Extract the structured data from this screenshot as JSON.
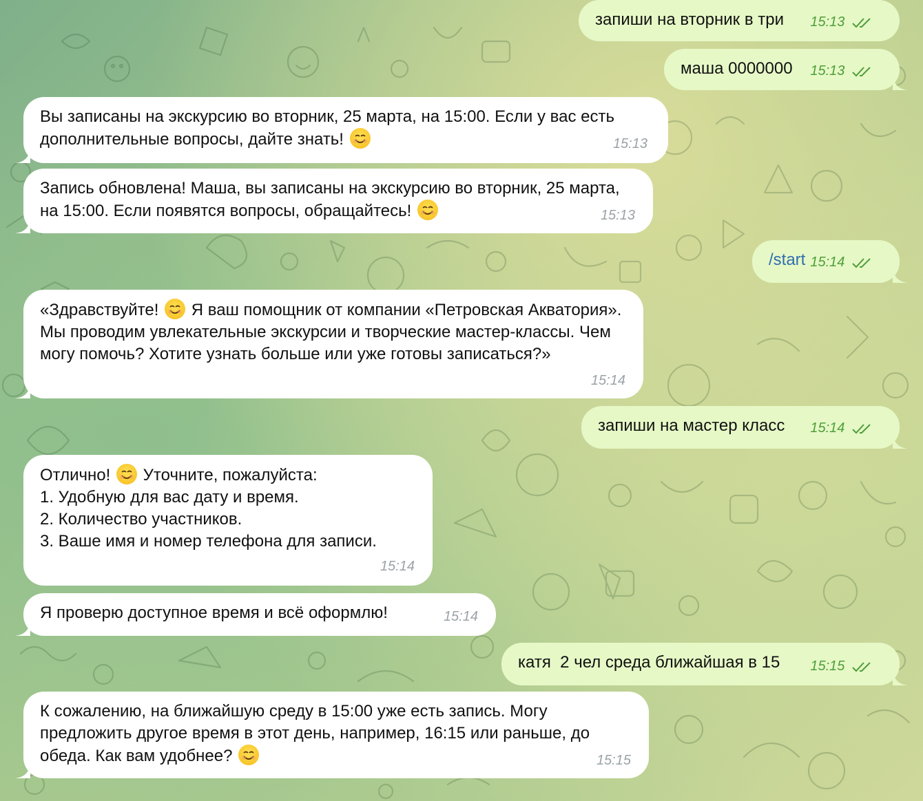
{
  "colors": {
    "incoming_bubble": "#ffffff",
    "outgoing_bubble": "#e6f8c6",
    "outgoing_time": "#4e9e3a",
    "incoming_time": "#9aa3a7",
    "command_link": "#2f6fb0"
  },
  "messages": [
    {
      "dir": "out",
      "text": "запиши на вторник в три",
      "time": "15:13"
    },
    {
      "dir": "out",
      "text": "маша 0000000",
      "time": "15:13"
    },
    {
      "dir": "in",
      "text_before": "Вы записаны на экскурсию во вторник, 25 марта, на 15:00. Если у вас есть дополнительные вопросы, дайте знать!",
      "text_after": "",
      "time": "15:13"
    },
    {
      "dir": "in",
      "text_before": "Запись обновлена! Маша, вы записаны на экскурсию во вторник, 25 марта, на 15:00. Если появятся вопросы, обращайтесь!",
      "text_after": "",
      "time": "15:13"
    },
    {
      "dir": "out",
      "text": "/start",
      "time": "15:14"
    },
    {
      "dir": "in",
      "text_before": "«Здравствуйте!",
      "text_after": "Я ваш помощник от компании «Петровская Акватория». Мы проводим увлекательные экскурсии и творческие мастер-классы. Чем могу помочь? Хотите узнать больше или уже готовы записаться?»",
      "time": "15:14"
    },
    {
      "dir": "out",
      "text": "запиши на мастер класс",
      "time": "15:14"
    },
    {
      "dir": "in",
      "text_before": "Отлично!",
      "text_after": "Уточните, пожалуйста:\n1. Удобную для вас дату и время.\n2. Количество участников.\n3. Ваше имя и номер телефона для записи.",
      "time": "15:14"
    },
    {
      "dir": "in",
      "text_before": "Я проверю доступное время и всё оформлю!",
      "text_after": "",
      "time": "15:14"
    },
    {
      "dir": "out",
      "text": "катя  2 чел среда ближайшая в 15",
      "time": "15:15"
    },
    {
      "dir": "in",
      "text_before": "К сожалению, на ближайшую среду в 15:00 уже есть запись. Могу предложить другое время в этот день, например, 16:15 или раньше, до обеда. Как вам удобнее?",
      "text_after": "",
      "time": "15:15"
    }
  ],
  "icons": {
    "emoji": "smiling-face-emoji",
    "read_receipt": "double-check-icon"
  }
}
